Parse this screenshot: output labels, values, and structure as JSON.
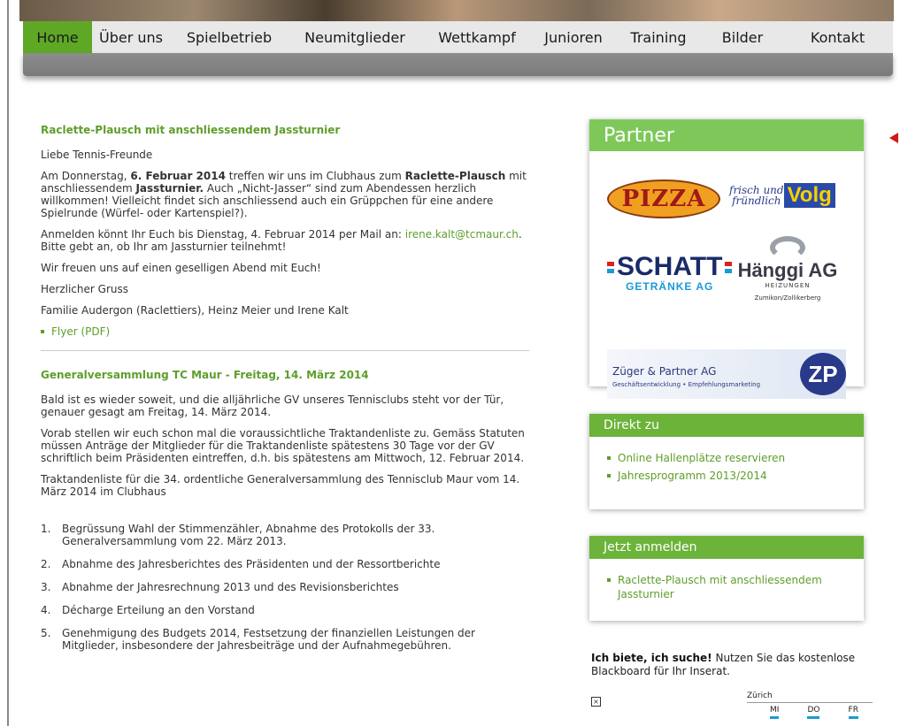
{
  "nav": {
    "items": [
      {
        "label": "Home",
        "active": true
      },
      {
        "label": "Über uns"
      },
      {
        "label": "Spielbetrieb"
      },
      {
        "label": "Neumitglieder"
      },
      {
        "label": "Wettkampf"
      },
      {
        "label": "Junioren"
      },
      {
        "label": "Training"
      },
      {
        "label": "Bilder"
      },
      {
        "label": "Kontakt"
      }
    ]
  },
  "article1": {
    "title": "Raclette-Plausch mit anschliessendem Jassturnier",
    "greeting": "Liebe Tennis-Freunde",
    "p1_a": "Am Donnerstag, ",
    "p1_b": "6. Februar 2014",
    "p1_c": " treffen wir uns im Clubhaus zum ",
    "p1_d": "Raclette-Plausch",
    "p1_e": " mit anschliessendem ",
    "p1_f": "Jassturnier.",
    "p1_g": " Auch „Nicht-Jasser“ sind zum Abendessen herzlich willkommen! Vielleicht findet sich anschliessend auch ein Grüppchen für eine andere Spielrunde (Würfel- oder Kartenspiel?).",
    "p2_a": "Anmelden könnt Ihr Euch bis Dienstag, 4. Februar 2014 per Mail an: ",
    "p2_email": "irene.kalt@tcmaur.ch",
    "p2_b": ". Bitte gebt an, ob Ihr am Jassturnier teilnehmt!",
    "p3": "Wir freuen uns auf einen geselligen Abend mit Euch!",
    "p4": "Herzlicher Gruss",
    "p5": "Familie Audergon (Raclettiers), Heinz Meier und Irene Kalt",
    "flyer": "Flyer (PDF)"
  },
  "article2": {
    "title": "Generalversammlung TC Maur - Freitag, 14. März 2014",
    "p1": "Bald ist es wieder soweit, und die alljährliche GV unseres Tennisclubs steht vor der Tür, genauer gesagt am Freitag, 14. März 2014.",
    "p2": "Vorab stellen wir euch schon mal die voraussichtliche Traktandenliste zu. Gemäss Statuten müssen Anträge der Mitglieder für die Traktandenliste spätestens 30 Tage vor der GV schriftlich beim Präsidenten eintreffen, d.h. bis spätestens am Mittwoch, 12. Februar 2014.",
    "p3": "Traktandenliste für die 34. ordentliche Generalversammlung des Tennisclub Maur vom 14. März 2014 im Clubhaus",
    "agenda": [
      {
        "n": "1.",
        "text": "Begrüssung Wahl der Stimmenzähler, Abnahme des Protokolls der 33. Generalversammlung vom 22. März 2013."
      },
      {
        "n": "2.",
        "text": "Abnahme des Jahresberichtes des Präsidenten und der Ressortberichte"
      },
      {
        "n": "3.",
        "text": "Abnahme der Jahresrechnung 2013 und des Revisionsberichtes"
      },
      {
        "n": "4.",
        "text": "Décharge Erteilung an den Vorstand"
      },
      {
        "n": "5.",
        "text": "Genehmigung des Budgets 2014, Festsetzung der finanziellen Leistungen der Mitglieder, insbesondere der Jahresbeiträge und der Aufnahmegebühren."
      }
    ]
  },
  "partner": {
    "title": "Partner",
    "pizza": "PIZZA",
    "volg_script_1": "frisch und",
    "volg_script_2": "fründlich",
    "volg_word": "Volg",
    "schatt_word": "SCHATT",
    "schatt_sub": "GETRÄNKE AG",
    "haenggi_word": "Hänggi AG",
    "haenggi_sub": "HEIZUNGEN",
    "haenggi_place": "Zumikon/Zollikerberg",
    "zueger_name": "Züger & Partner AG",
    "zueger_tag": "Geschäftsentwicklung • Empfehlungsmarketing",
    "zp": "ZP"
  },
  "direkt": {
    "title": "Direkt zu",
    "links": [
      "Online Hallenplätze reservieren",
      "Jahresprogramm 2013/2014"
    ]
  },
  "anmelden": {
    "title": "Jetzt anmelden",
    "links": [
      "Raclette-Plausch mit anschliessendem Jassturnier"
    ]
  },
  "blackboard": {
    "bold": "Ich biete, ich suche!",
    "text": " Nutzen Sie das kostenlose Blackboard für Ihr Inserat."
  },
  "weather": {
    "city": "Zürich",
    "days": [
      "MI",
      "DO",
      "FR"
    ]
  },
  "colors": {
    "accent": "#5ea826",
    "link": "#5e9e2a",
    "box_title": "#6cb33a"
  }
}
